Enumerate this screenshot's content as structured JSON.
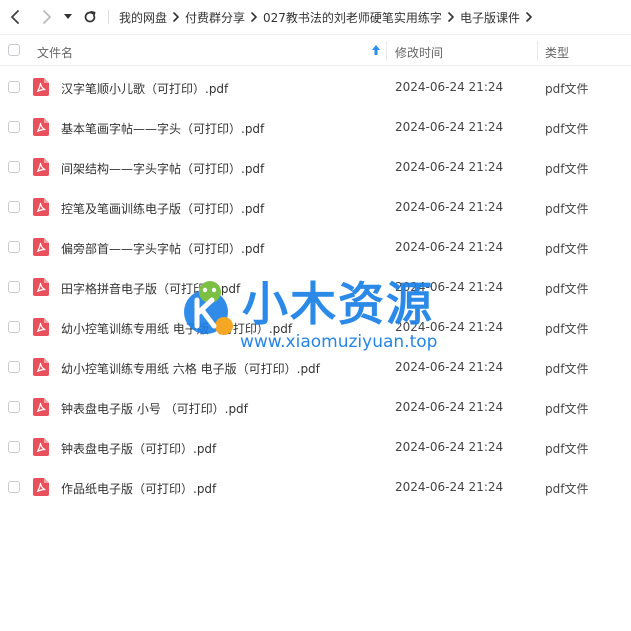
{
  "toolbar": {
    "dropdown_icon": "caret-down-icon",
    "breadcrumb": [
      "我的网盘",
      "付费群分享",
      "027教书法的刘老师硬笔实用练字",
      "电子版课件"
    ]
  },
  "table": {
    "columns": {
      "name": "文件名",
      "time": "修改时间",
      "type": "类型"
    },
    "sort_icon": "sort-up-arrow-icon",
    "rows": [
      {
        "name": "汉字笔顺小儿歌（可打印）.pdf",
        "time": "2024-06-24 21:24",
        "type": "pdf文件"
      },
      {
        "name": "基本笔画字帖——字头（可打印）.pdf",
        "time": "2024-06-24 21:24",
        "type": "pdf文件"
      },
      {
        "name": "间架结构——字头字帖（可打印）.pdf",
        "time": "2024-06-24 21:24",
        "type": "pdf文件"
      },
      {
        "name": "控笔及笔画训练电子版（可打印）.pdf",
        "time": "2024-06-24 21:24",
        "type": "pdf文件"
      },
      {
        "name": "偏旁部首——字头字帖（可打印）.pdf",
        "time": "2024-06-24 21:24",
        "type": "pdf文件"
      },
      {
        "name": "田字格拼音电子版（可打印）.pdf",
        "time": "2024-06-24 21:24",
        "type": "pdf文件"
      },
      {
        "name": "幼小控笔训练专用纸 电子版（可打印）.pdf",
        "time": "2024-06-24 21:24",
        "type": "pdf文件"
      },
      {
        "name": "幼小控笔训练专用纸 六格 电子版（可打印）.pdf",
        "time": "2024-06-24 21:24",
        "type": "pdf文件"
      },
      {
        "name": "钟表盘电子版 小号 （可打印）.pdf",
        "time": "2024-06-24 21:24",
        "type": "pdf文件"
      },
      {
        "name": "钟表盘电子版（可打印）.pdf",
        "time": "2024-06-24 21:24",
        "type": "pdf文件"
      },
      {
        "name": "作品纸电子版（可打印）.pdf",
        "time": "2024-06-24 21:24",
        "type": "pdf文件"
      }
    ]
  },
  "watermark": {
    "title": "小木资源",
    "url": "www.xiaomuziyuan.top"
  },
  "colors": {
    "pdf_icon": "#e8505b",
    "watermark": "#1a7fe6"
  }
}
